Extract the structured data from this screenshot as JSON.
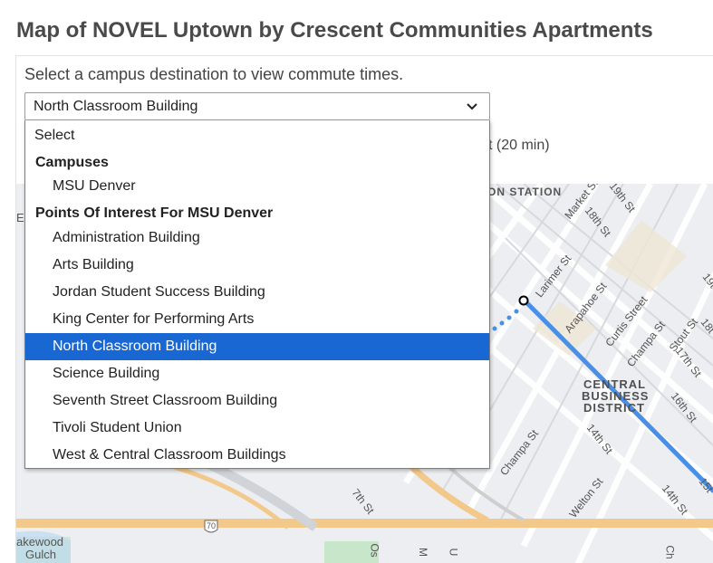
{
  "page": {
    "title": "Map of NOVEL Uptown by Crescent Communities Apartments"
  },
  "commute": {
    "prompt": "Select a campus destination to view commute times.",
    "selected_value": "North Classroom Building",
    "partial_result": "t (20 min)"
  },
  "dropdown": {
    "default_option": "Select",
    "groups": [
      {
        "label": "Campuses",
        "options": [
          "MSU Denver"
        ]
      },
      {
        "label": "Points Of Interest For MSU Denver",
        "options": [
          "Administration Building",
          "Arts Building",
          "Jordan Student Success Building",
          "King Center for Performing Arts",
          "North Classroom Building",
          "Science Building",
          "Seventh Street Classroom Building",
          "Tivoli Student Union",
          "West & Central Classroom Buildings"
        ]
      }
    ],
    "selected_index_in_group": 4
  },
  "map": {
    "labels": {
      "station": "ON STATION",
      "market_st": "Market St",
      "st_19th": "19th St",
      "st_18th": "18th St",
      "larimer_st": "Larimer St",
      "arapahoe_st": "Arapahoe St",
      "curtis_street": "Curtis Street",
      "champa_st": "Champa St",
      "stout_st": "Stout St",
      "st_17th": "17th St",
      "st_18th_b": "18t",
      "st_19th_b": "19t",
      "cbd_1": "CENTRAL",
      "cbd_2": "BUSINESS",
      "cbd_3": "DISTRICT",
      "st_16th": "16th St",
      "st_14th": "14th St",
      "champa_st_b": "Champa St",
      "welton_st": "Welton St",
      "st_14th_b": "14th St",
      "st_15th": "15t",
      "st_7th": "7th St",
      "lakewood": "akewood",
      "gulch": "Gulch",
      "edge_e": "E",
      "i70": "70",
      "cut_os": "Os",
      "cut_m": "M",
      "cut_u": "U",
      "cut_ch": "Ch"
    },
    "colors": {
      "route": "#4a8fe7",
      "highway": "#f3c98b",
      "water": "#b5d7f2",
      "park": "#c8e6c9",
      "block": "#f0eae0"
    }
  }
}
